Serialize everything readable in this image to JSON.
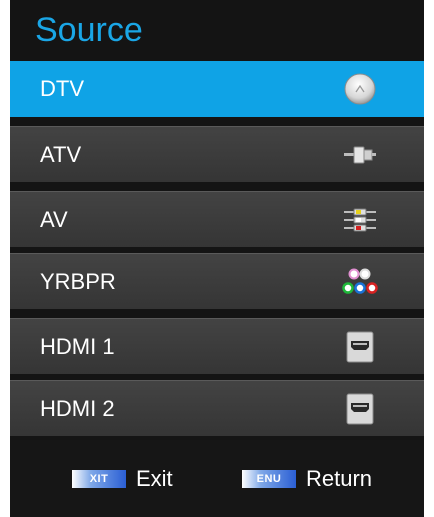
{
  "menu": {
    "title": "Source",
    "items": [
      {
        "label": "DTV",
        "icon": "satellite-icon",
        "selected": true
      },
      {
        "label": "ATV",
        "icon": "antenna-connector-icon",
        "selected": false
      },
      {
        "label": "AV",
        "icon": "av-cable-icon",
        "selected": false
      },
      {
        "label": "YRBPR",
        "icon": "component-ports-icon",
        "selected": false
      },
      {
        "label": "HDMI 1",
        "icon": "hdmi-port-icon",
        "selected": false
      },
      {
        "label": "HDMI 2",
        "icon": "hdmi-port-icon",
        "selected": false
      }
    ]
  },
  "footer": {
    "exit_key": "XIT",
    "exit_label": "Exit",
    "menu_key": "ENU",
    "return_label": "Return"
  },
  "colors": {
    "accent": "#0fa3e6",
    "title": "#1aa6e6",
    "background": "#141414"
  }
}
